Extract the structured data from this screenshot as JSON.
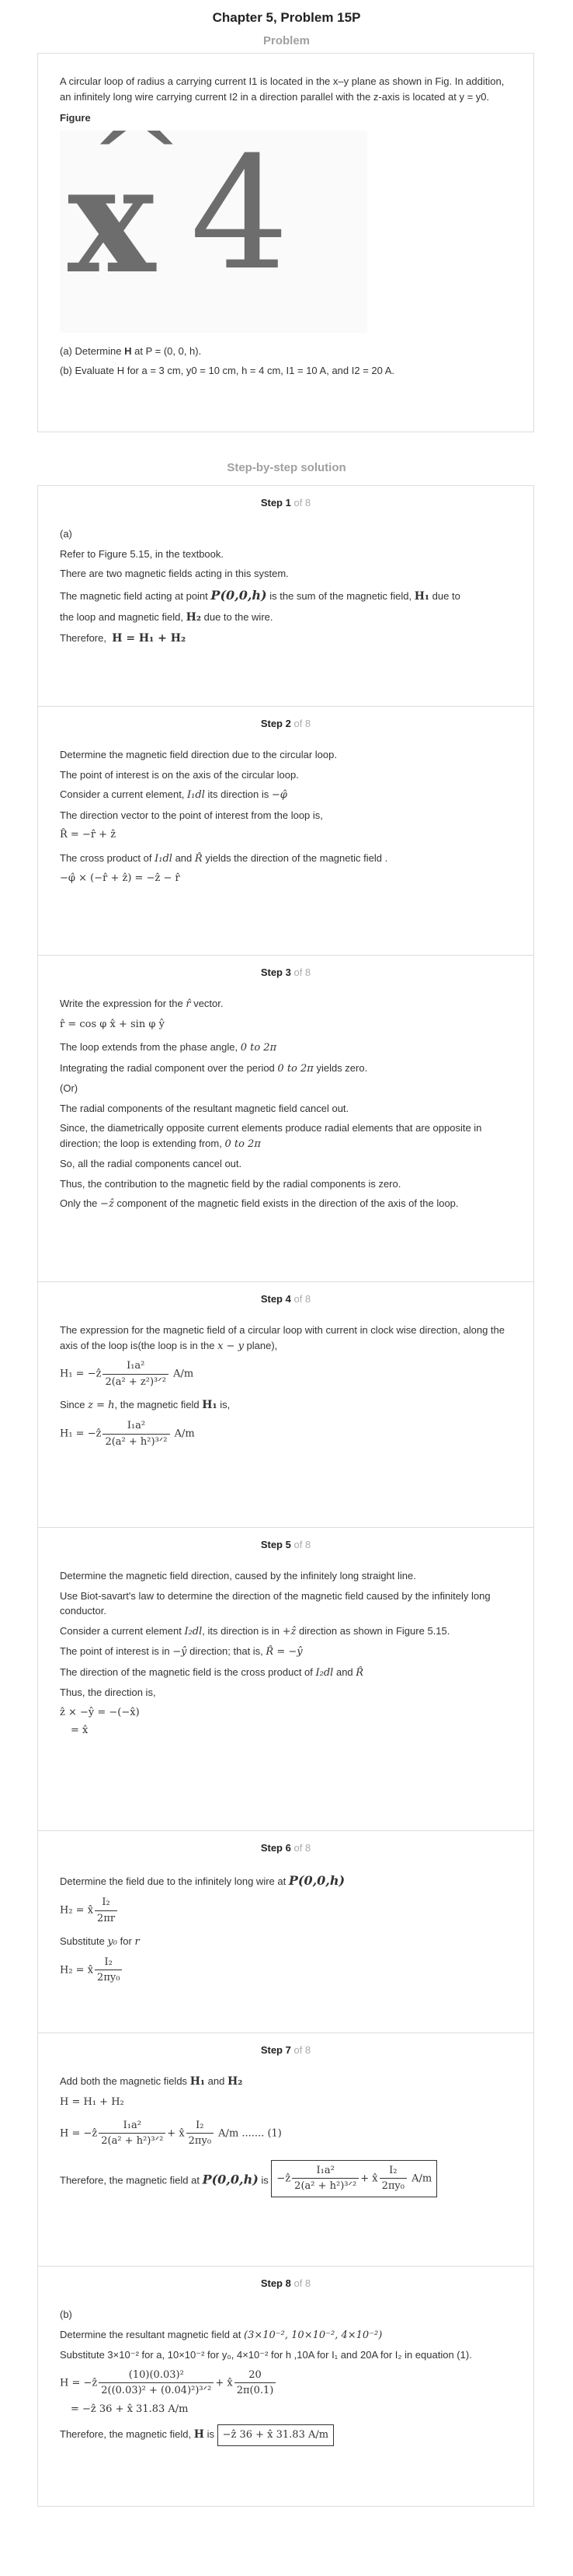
{
  "title": "Chapter 5, Problem 15P",
  "problem_label": "Problem",
  "problem": {
    "statement": "A circular loop of radius a carrying current I1 is located in the x–y plane as shown in Fig. In addition, an infinitely long wire carrying current I2 in a direction parallel with the z-axis is located at y = y0.",
    "figure_label": "Figure",
    "figure_text_hat": "^",
    "figure_text_x": "x",
    "figure_text_4": "4",
    "part_a_prefix": "(a) Determine",
    "part_a_bold": "H",
    "part_a_suffix": "at P = (0, 0, h).",
    "part_b": "(b) Evaluate H for a = 3 cm, y0 = 10 cm, h = 4 cm, I1 = 10 A, and I2 = 20 A."
  },
  "solution_label": "Step-by-step solution",
  "steps": [
    {
      "step": "Step 1",
      "of": "of 8",
      "part": "(a)",
      "l1": "Refer to Figure 5.15, in the textbook.",
      "l2": "There are two magnetic fields acting in this system.",
      "l3a": "The magnetic field acting at point",
      "l3pt": "P(0,0,h)",
      "l3b": "is the sum of the magnetic field,",
      "l3h1": "H₁",
      "l3c": "due to",
      "l4a": "the loop and magnetic field,",
      "l4h2": "H₂",
      "l4b": "due to the wire.",
      "l5a": "Therefore,",
      "l5eq": "H = H₁ + H₂"
    },
    {
      "step": "Step 2",
      "of": "of 8",
      "l1": "Determine the magnetic field direction due to the circular loop.",
      "l2": "The point of interest is on the axis of the circular loop.",
      "l3a": "Consider a current element,",
      "l3m": "I₁dl",
      "l3b": "its direction is",
      "l3dir": "−φ̂",
      "l4": "The direction vector to the point of interest from the loop is,",
      "eq1": "R̂ = −r̂ + ẑ",
      "l5a": "The cross product of",
      "l5m": "I₁dl",
      "l5b": "and",
      "l5r": "R̂",
      "l5c": "yields the direction of the magnetic field .",
      "eq2": "−φ̂ × (−r̂ + ẑ) = −ẑ − r̂"
    },
    {
      "step": "Step 3",
      "of": "of 8",
      "l1a": "Write the expression for the",
      "l1m": "r̂",
      "l1b": "vector.",
      "eq1": "r̂ = cos φ x̂ + sin φ ŷ",
      "l2a": "The loop extends from the phase angle,",
      "l2m": "0 to 2π",
      "l3a": "Integrating the radial component over the period",
      "l3m": "0 to 2π",
      "l3b": "yields zero.",
      "l4": "(Or)",
      "l5": "The radial components of the resultant magnetic field cancel out.",
      "l6a": "Since, the diametrically opposite current elements produce radial elements that are opposite in direction; the loop is extending from,",
      "l6m": "0 to 2π",
      "l7": "So, all the radial components cancel out.",
      "l8": "Thus, the contribution to the magnetic field by the radial components is zero.",
      "l9a": "Only the",
      "l9m": "−ẑ",
      "l9b": "component of the magnetic field exists in the direction of the axis of the loop."
    },
    {
      "step": "Step 4",
      "of": "of 8",
      "l1a": "The expression for the magnetic field of a circular loop with current in clock wise direction, along the axis of the loop is(the loop is in the",
      "l1m": "x − y",
      "l1b": "plane),",
      "eq1_lhs": "H₁ = −ẑ",
      "eq1_num": "I₁a²",
      "eq1_den": "2(a² + z²)³ᐟ²",
      "eq1_unit": "A/m",
      "l2a": "Since",
      "l2m": "z = h",
      "l2b": ", the magnetic field",
      "l2h": "H₁",
      "l2c": "is,",
      "eq2_lhs": "H₁ = −ẑ",
      "eq2_num": "I₁a²",
      "eq2_den": "2(a² + h²)³ᐟ²",
      "eq2_unit": "A/m"
    },
    {
      "step": "Step 5",
      "of": "of 8",
      "l1": "Determine the magnetic field direction, caused by the infinitely long straight line.",
      "l2": "Use Biot-savart's law to determine the direction of the magnetic field caused by the infinitely long conductor.",
      "l3a": "Consider a current element",
      "l3m": "I₂dl",
      "l3b": ", its direction is in",
      "l3d": "+ẑ",
      "l3c": "direction as shown in Figure 5.15.",
      "l4a": "The point of interest is in",
      "l4m": "−ŷ",
      "l4b": "direction; that is,",
      "l4eq": "R̂ = −ŷ",
      "l5a": "The direction of the magnetic field is the cross product of",
      "l5m": "I₂dl",
      "l5b": "and",
      "l5r": "R̂",
      "l6": "Thus, the direction is,",
      "eq1": "ẑ × −ŷ = −(−x̂)",
      "eq2": "= x̂"
    },
    {
      "step": "Step 6",
      "of": "of 8",
      "l1a": "Determine the field due to the infinitely long wire at",
      "l1pt": "P(0,0,h)",
      "eq1_lhs": "H₂ = x̂",
      "eq1_num": "I₂",
      "eq1_den": "2πr",
      "l2a": "Substitute",
      "l2m1": "y₀",
      "l2b": "for",
      "l2m2": "r",
      "eq2_lhs": "H₂ = x̂",
      "eq2_num": "I₂",
      "eq2_den": "2πy₀"
    },
    {
      "step": "Step 7",
      "of": "of 8",
      "l1a": "Add both the magnetic fields",
      "l1h1": "H₁",
      "l1b": "and",
      "l1h2": "H₂",
      "eq1": "H = H₁ + H₂",
      "eq2_lhs": "H = −ẑ",
      "eq2_num1": "I₁a²",
      "eq2_den1": "2(a² + h²)³ᐟ²",
      "eq2_mid": "+ x̂",
      "eq2_num2": "I₂",
      "eq2_den2": "2πy₀",
      "eq2_unit": "A/m ....... (1)",
      "l2a": "Therefore, the magnetic field at",
      "l2pt": "P(0,0,h)",
      "l2b": "is",
      "box_lhs": "−ẑ",
      "box_num1": "I₁a²",
      "box_den1": "2(a² + h²)³ᐟ²",
      "box_mid": "+ x̂",
      "box_num2": "I₂",
      "box_den2": "2πy₀",
      "box_unit": "A/m"
    },
    {
      "step": "Step 8",
      "of": "of 8",
      "part": "(b)",
      "l1a": "Determine the resultant magnetic field at",
      "l1m": "(3×10⁻², 10×10⁻², 4×10⁻²)",
      "l2": "Substitute  3×10⁻² for  a,  10×10⁻² for  y₀,  4×10⁻² for  h ,10A for  I₁ and 20A for  I₂ in equation (1).",
      "eq1_lhs": "H = −ẑ",
      "eq1_num1": "(10)(0.03)²",
      "eq1_den1": "2((0.03)² + (0.04)²)³ᐟ²",
      "eq1_mid": "+ x̂",
      "eq1_num2": "20",
      "eq1_den2": "2π(0.1)",
      "eq2": "= −ẑ 36 + x̂ 31.83 A/m",
      "l3a": "Therefore, the magnetic field,",
      "l3h": "H",
      "l3b": "is",
      "l3box": "−ẑ 36 + x̂ 31.83 A/m"
    }
  ]
}
